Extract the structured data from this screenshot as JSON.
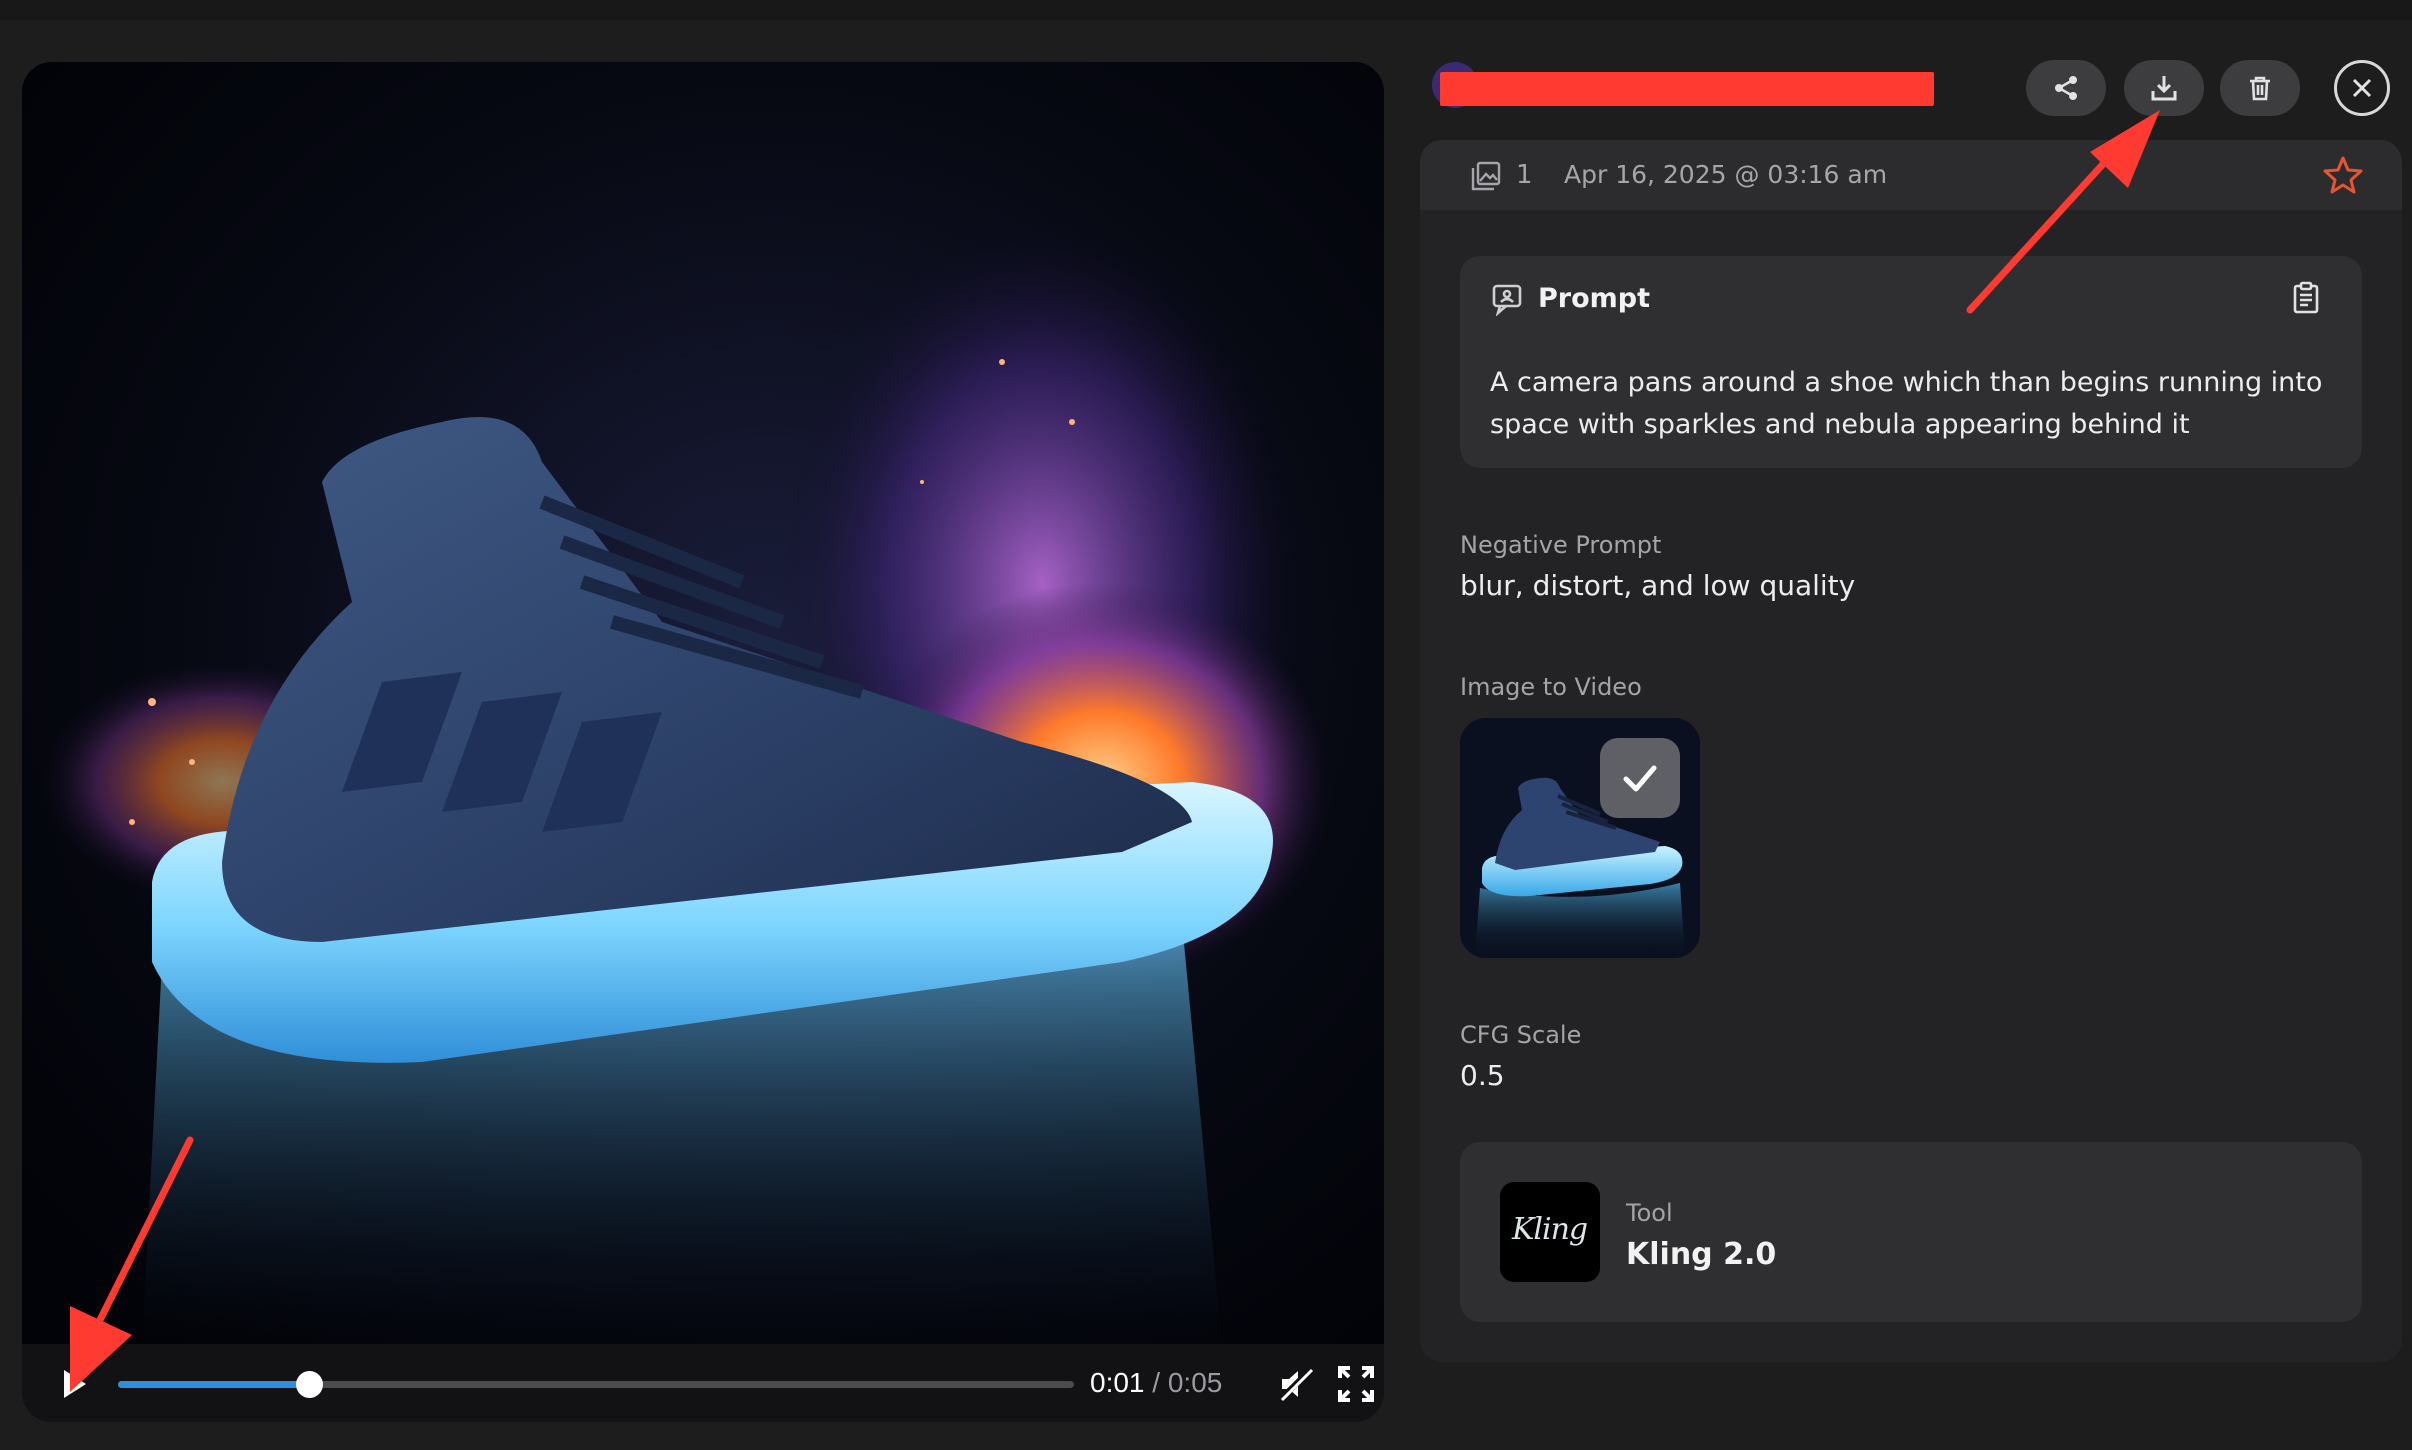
{
  "video": {
    "current_time": "0:01",
    "separator": "/",
    "duration": "0:05",
    "progress": 0.2
  },
  "header": {
    "icons": [
      "share-icon",
      "download-icon",
      "trash-icon",
      "close-icon"
    ]
  },
  "meta": {
    "image_count": "1",
    "date": "Apr 16, 2025 @ 03:16 am"
  },
  "prompt": {
    "title": "Prompt",
    "text": "A camera pans around a shoe which than begins running into space with sparkles and nebula appearing behind it"
  },
  "negative_prompt": {
    "label": "Negative Prompt",
    "value": "blur, distort, and low quality"
  },
  "image_to_video": {
    "label": "Image to Video"
  },
  "cfg_scale": {
    "label": "CFG Scale",
    "value": "0.5"
  },
  "tool": {
    "label": "Tool",
    "name": "Kling 2.0",
    "logo_text": "Kling"
  },
  "colors": {
    "accent_blue": "#2b8fe0",
    "star_orange": "#e8542f",
    "annotation_red": "#ff3a31"
  }
}
